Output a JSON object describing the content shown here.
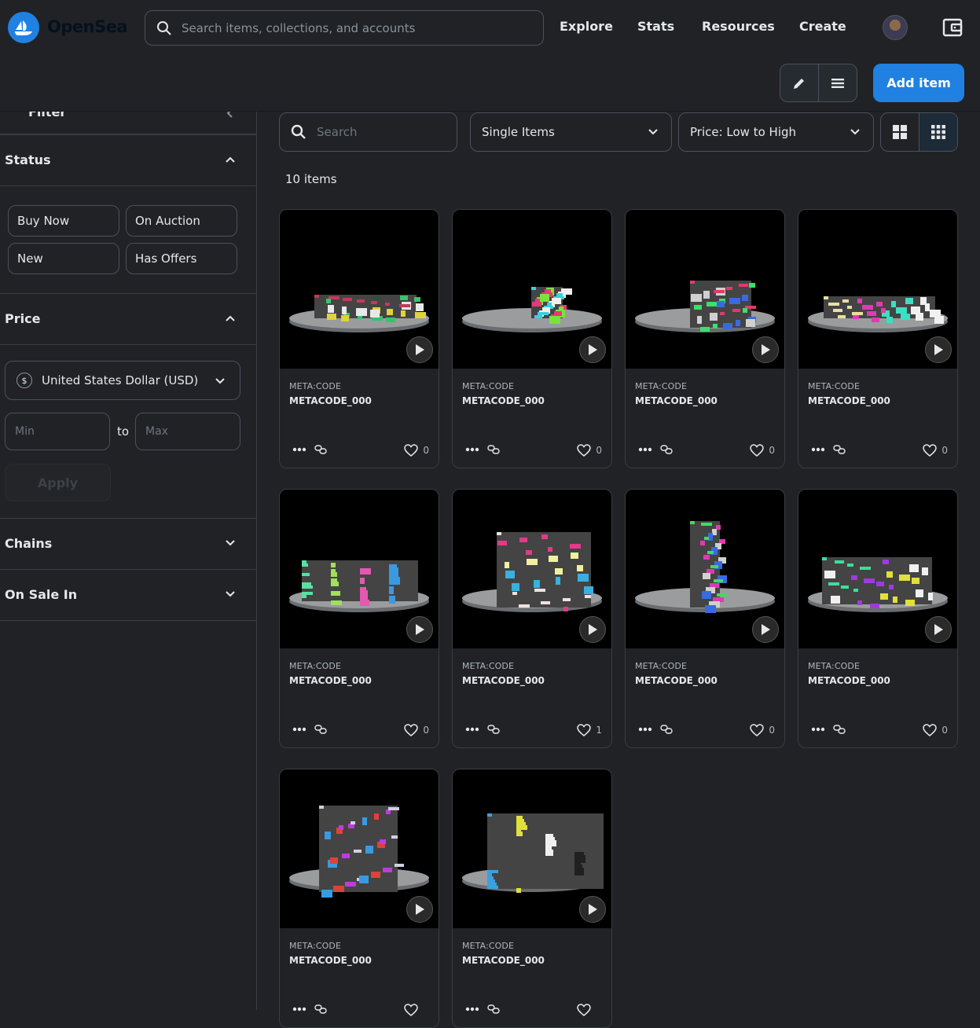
{
  "header": {
    "brand": "OpenSea",
    "search_placeholder": "Search items, collections, and accounts",
    "nav": [
      "Explore",
      "Stats",
      "Resources",
      "Create"
    ]
  },
  "toolbar": {
    "add_item": "Add item"
  },
  "sidebar": {
    "filter_label": "Filter",
    "status": {
      "title": "Status",
      "chips": [
        "Buy Now",
        "On Auction",
        "New",
        "Has Offers"
      ]
    },
    "price": {
      "title": "Price",
      "currency": "United States Dollar (USD)",
      "currency_symbol": "$",
      "min_placeholder": "Min",
      "to": "to",
      "max_placeholder": "Max",
      "apply": "Apply"
    },
    "chains": "Chains",
    "on_sale_in": "On Sale In"
  },
  "main": {
    "search_placeholder": "Search",
    "item_type": "Single Items",
    "sort": "Price: Low to High",
    "count": "10 items"
  },
  "items": [
    {
      "collection": "META:CODE",
      "name": "METACODE_000",
      "likes": "0",
      "art": "car"
    },
    {
      "collection": "META:CODE",
      "name": "METACODE_000",
      "likes": "0",
      "art": "bike"
    },
    {
      "collection": "META:CODE",
      "name": "METACODE_000",
      "likes": "0",
      "art": "moto"
    },
    {
      "collection": "META:CODE",
      "name": "METACODE_000",
      "likes": "0",
      "art": "wall"
    },
    {
      "collection": "META:CODE",
      "name": "METACODE_000",
      "likes": "0",
      "art": "container"
    },
    {
      "collection": "META:CODE",
      "name": "METACODE_000",
      "likes": "1",
      "art": "box"
    },
    {
      "collection": "META:CODE",
      "name": "METACODE_000",
      "likes": "0",
      "art": "pole"
    },
    {
      "collection": "META:CODE",
      "name": "METACODE_000",
      "likes": "0",
      "art": "shop"
    },
    {
      "collection": "META:CODE",
      "name": "METACODE_000",
      "likes": "",
      "art": "booth"
    },
    {
      "collection": "META:CODE",
      "name": "METACODE_000",
      "likes": "",
      "art": "shutter"
    }
  ],
  "colors": {
    "accent": "#2081e2",
    "bg": "#202225",
    "card": "#303339"
  }
}
